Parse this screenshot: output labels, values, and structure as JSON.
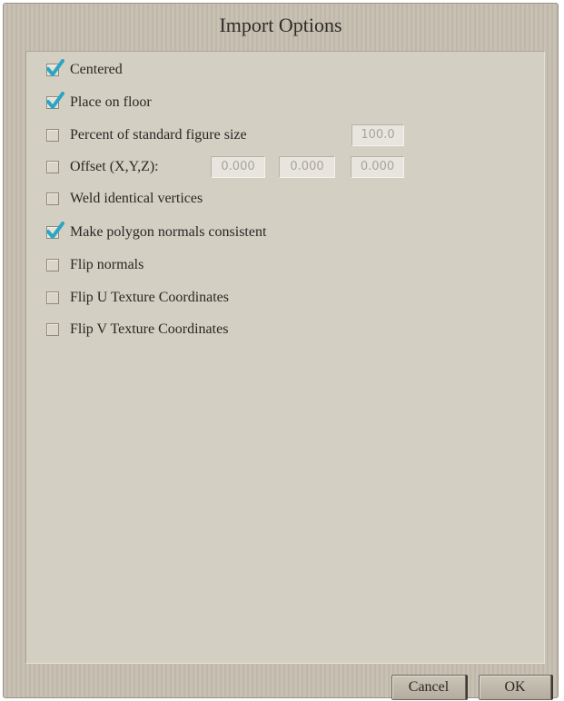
{
  "dialog": {
    "title": "Import Options"
  },
  "options": [
    {
      "label": "Centered",
      "checked": true
    },
    {
      "label": "Place on floor",
      "checked": true
    },
    {
      "label": "Percent of standard figure size",
      "checked": false
    },
    {
      "label": "Offset (X,Y,Z):",
      "checked": false
    },
    {
      "label": "Weld identical vertices",
      "checked": false
    },
    {
      "label": "Make polygon normals consistent",
      "checked": true
    },
    {
      "label": "Flip normals",
      "checked": false
    },
    {
      "label": "Flip U Texture Coordinates",
      "checked": false
    },
    {
      "label": "Flip V Texture Coordinates",
      "checked": false
    }
  ],
  "fields": {
    "percent": "100.0",
    "offset_x": "0.000",
    "offset_y": "0.000",
    "offset_z": "0.000"
  },
  "buttons": {
    "cancel": "Cancel",
    "ok": "OK"
  },
  "colors": {
    "check": "#2aa6c4",
    "panel": "#d4cfc3",
    "frame": "#c3bcaf"
  },
  "icons": {
    "checkmark": "checkmark-icon"
  }
}
